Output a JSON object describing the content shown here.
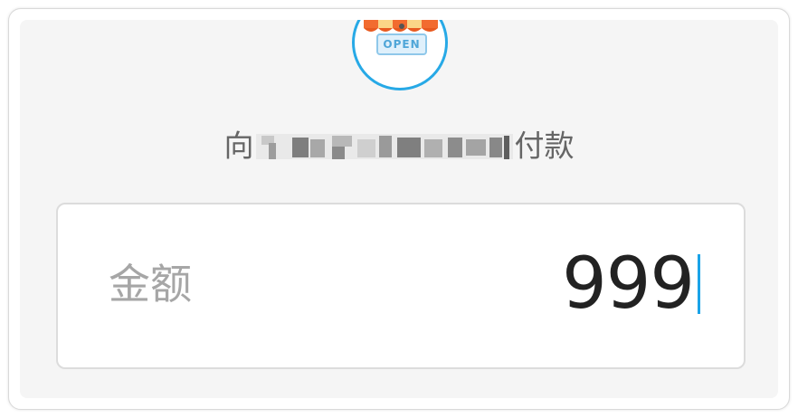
{
  "merchant": {
    "avatar_icon": "storefront-open-icon",
    "open_sign_text": "OPEN",
    "payee_prefix": "向",
    "payee_suffix": "付款"
  },
  "amount": {
    "label": "金额",
    "value": "999"
  },
  "colors": {
    "accent": "#1aa3e8",
    "avatar_border": "#27a9e6",
    "panel_bg": "#f5f5f5"
  }
}
